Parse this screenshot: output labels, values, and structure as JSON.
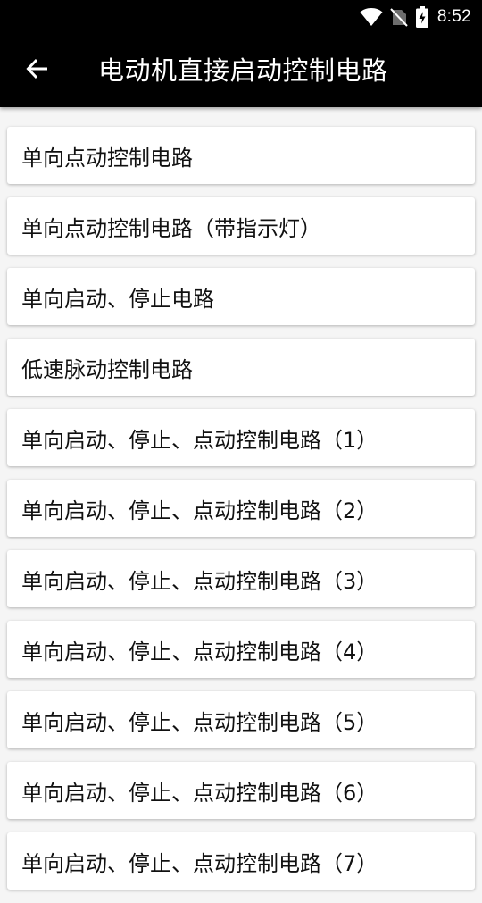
{
  "status_bar": {
    "time": "8:52",
    "icons": [
      "wifi-icon",
      "no-sim-icon",
      "battery-charging-icon"
    ]
  },
  "app_bar": {
    "back_icon": "arrow-back-icon",
    "title": "电动机直接启动控制电路"
  },
  "items": [
    "单向点动控制电路",
    "单向点动控制电路（带指示灯）",
    "单向启动、停止电路",
    "低速脉动控制电路",
    "单向启动、停止、点动控制电路（1）",
    "单向启动、停止、点动控制电路（2）",
    "单向启动、停止、点动控制电路（3）",
    "单向启动、停止、点动控制电路（4）",
    "单向启动、停止、点动控制电路（5）",
    "单向启动、停止、点动控制电路（6）",
    "单向启动、停止、点动控制电路（7）"
  ],
  "colors": {
    "app_bar": "#000000",
    "background": "#f5f5f5",
    "card": "#ffffff",
    "text": "#111111"
  }
}
